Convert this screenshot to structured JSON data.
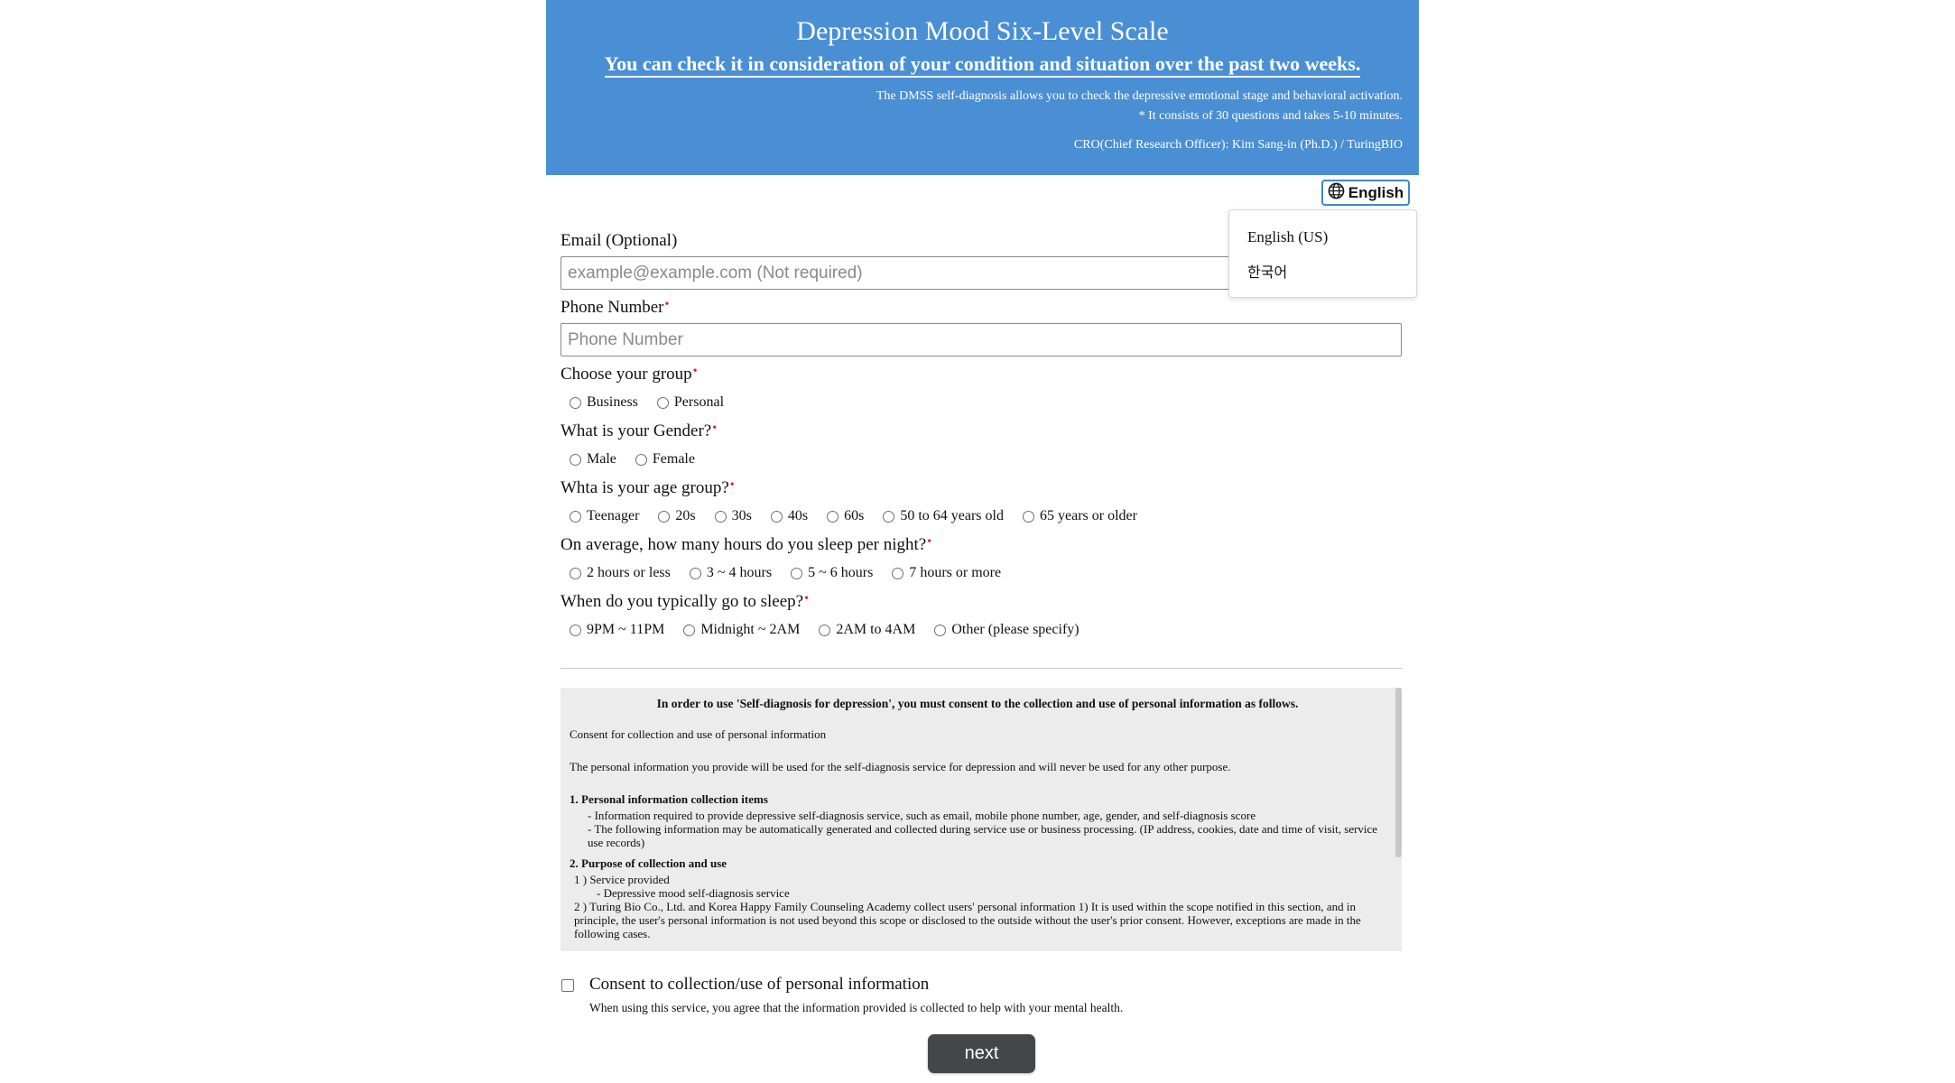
{
  "header": {
    "title": "Depression Mood Six-Level Scale",
    "subtitle": "You can check it in consideration of your condition and situation over the past two weeks.",
    "description_1": "The DMSS self-diagnosis allows you to check the depressive emotional stage and behavioral activation.",
    "description_2": "* It consists of 30 questions and takes 5-10 minutes.",
    "cro": "CRO(Chief Research Officer): Kim Sang-in (Ph.D.) / TuringBIO"
  },
  "language": {
    "button_label": "English",
    "icon": "globe-icon",
    "options": [
      "English (US)",
      "한국어"
    ]
  },
  "form": {
    "email": {
      "label": "Email (Optional)",
      "placeholder": "example@example.com (Not required)"
    },
    "phone": {
      "label": "Phone Number",
      "placeholder": "Phone Number"
    },
    "required_marker": "•",
    "group": {
      "label": "Choose your group",
      "options": [
        "Business",
        "Personal"
      ]
    },
    "gender": {
      "label": "What is your Gender?",
      "options": [
        "Male",
        "Female"
      ]
    },
    "age": {
      "label": "Whta is your age group?",
      "options": [
        "Teenager",
        "20s",
        "30s",
        "40s",
        "60s",
        "50 to 64 years old",
        "65 years or older"
      ]
    },
    "sleep_hours": {
      "label": "On average, how many hours do you sleep per night?",
      "options": [
        "2 hours or less",
        "3 ~ 4 hours",
        "5 ~ 6 hours",
        "7 hours or more"
      ]
    },
    "bedtime": {
      "label": "When do you typically go to sleep?",
      "options": [
        "9PM ~ 11PM",
        "Midnight ~ 2AM",
        "2AM to 4AM",
        "Other (please specify)"
      ]
    }
  },
  "consent": {
    "heading": "In order to use 'Self-diagnosis for depression', you must consent to the collection and use of personal information as follows.",
    "intro": "Consent for collection and use of personal information",
    "purpose_statement": "The personal information you provide will be used for the self-diagnosis service for depression and will never be used for any other purpose.",
    "section1_title": "1. Personal information collection items",
    "section1_item1": "- Information required to provide depressive self-diagnosis service, such as email, mobile phone number, age, gender, and self-diagnosis score",
    "section1_item2": "- The following information may be automatically generated and collected during service use or business processing. (IP address, cookies, date and time of visit, service use records)",
    "section2_title": "2. Purpose of collection and use",
    "section2_item1": "1 ) Service provided",
    "section2_item1_sub": "- Depressive mood self-diagnosis service",
    "section2_item2": "2 ) Turing Bio Co., Ltd. and Korea Happy Family Counseling Academy collect users' personal information 1) It is used within the scope notified in this section, and in principle, the user's personal information is not used beyond this scope or disclosed to the outside without the user's prior consent. However, exceptions are made in the following cases.",
    "checkbox_label": "Consent to collection/use of personal information",
    "checkbox_note": "When using this service, you agree that the information provided is collected to help with your mental health."
  },
  "actions": {
    "next_label": "next"
  }
}
